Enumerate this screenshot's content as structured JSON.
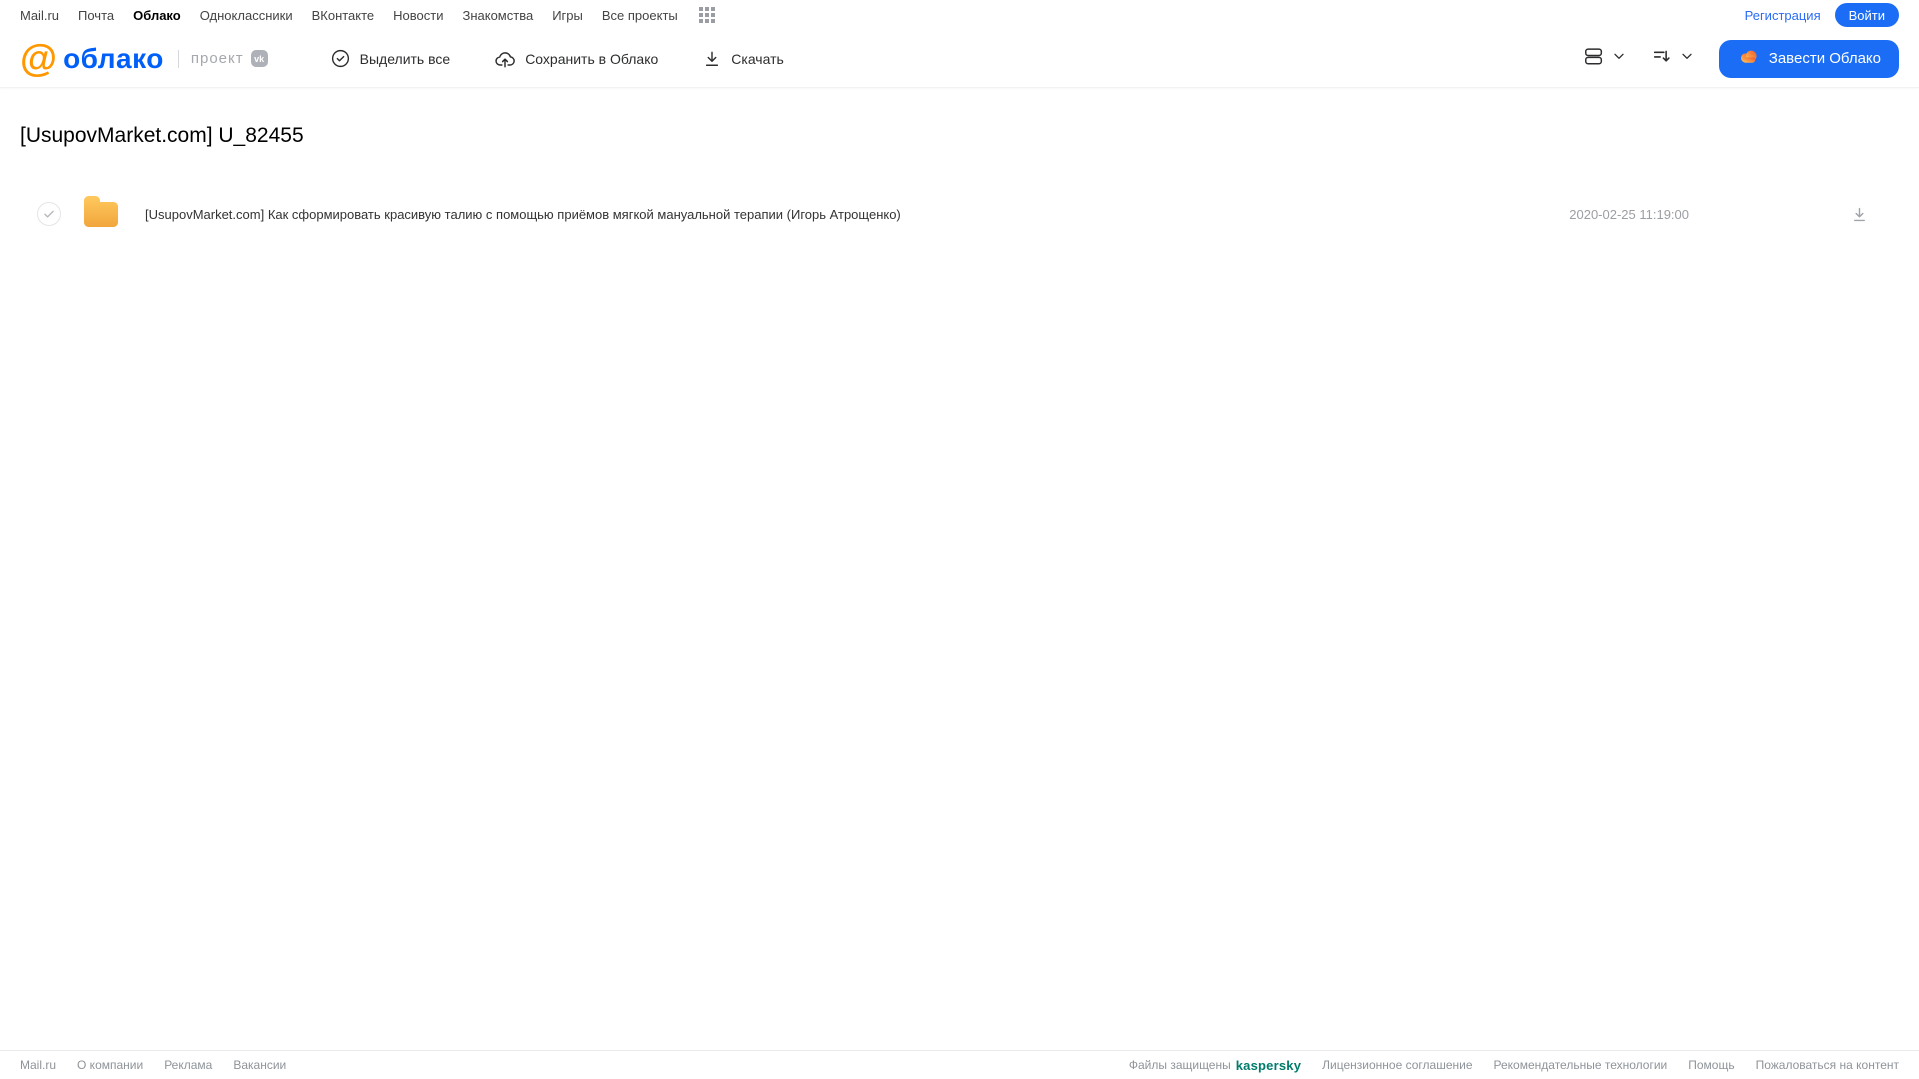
{
  "top_nav": {
    "items": [
      "Mail.ru",
      "Почта",
      "Облако",
      "Одноклассники",
      "ВКонтакте",
      "Новости",
      "Знакомства",
      "Игры",
      "Все проекты"
    ],
    "active_item": "Облако",
    "registration_label": "Регистрация",
    "login_label": "Войти"
  },
  "header": {
    "logo_at": "@",
    "logo_text": "облако",
    "project_label": "проект",
    "vk_badge_text": "vk",
    "toolbar": {
      "select_all_label": "Выделить все",
      "save_to_cloud_label": "Сохранить в Облако",
      "download_label": "Скачать"
    },
    "get_cloud_button_label": "Завести Облако",
    "icons": [
      "check-circle-icon",
      "cloud-upload-icon",
      "download-icon",
      "view-toggle-icon",
      "sort-icon",
      "chevron-down-icon",
      "cloud-icon"
    ]
  },
  "main": {
    "title": "[UsupovMarket.com] U_82455",
    "files": [
      {
        "type": "folder",
        "name": "[UsupovMarket.com] Как сформировать красивую талию с помощью приёмов мягкой мануальной терапии (Игорь Атрощенко)",
        "date": "2020-02-25 11:19:00"
      }
    ]
  },
  "footer": {
    "left_links": [
      "Mail.ru",
      "О компании",
      "Реклама",
      "Вакансии"
    ],
    "protected_label": "Файлы защищены",
    "kaspersky_label": "kaspersky",
    "right_links": [
      "Лицензионное соглашение",
      "Рекомендательные технологии",
      "Помощь",
      "Пожаловаться на контент"
    ]
  },
  "colors": {
    "accent_blue": "#1b6df5",
    "logo_blue": "#005ff9",
    "logo_orange": "#ff9800",
    "kaspersky_green": "#007c6c",
    "folder_gradient_top": "#ffc95e",
    "folder_gradient_bottom": "#f1a63c",
    "cloud_icon_gradient": [
      "#ffc657",
      "#f2572d"
    ]
  }
}
